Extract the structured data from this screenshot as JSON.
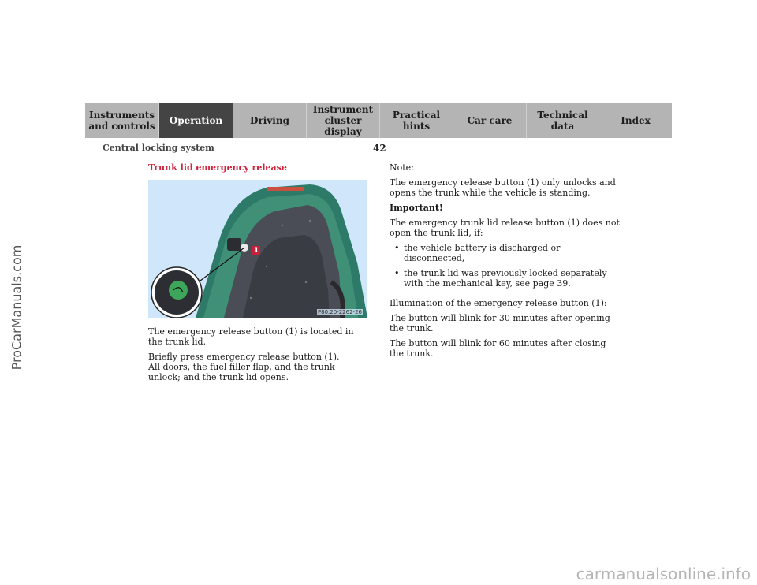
{
  "watermark_side": "ProCarManuals.com",
  "watermark_bottom": "carmanualsonline.info",
  "nav": {
    "tabs": [
      {
        "label": "Instruments\nand controls",
        "active": false
      },
      {
        "label": "Operation",
        "active": true
      },
      {
        "label": "Driving",
        "active": false
      },
      {
        "label": "Instrument\ncluster display",
        "active": false
      },
      {
        "label": "Practical hints",
        "active": false
      },
      {
        "label": "Car care",
        "active": false
      },
      {
        "label": "Technical\ndata",
        "active": false
      },
      {
        "label": "Index",
        "active": false
      }
    ]
  },
  "header": {
    "section": "Central locking system",
    "page_number": "42"
  },
  "content": {
    "title": "Trunk lid emergency release",
    "figure": {
      "code": "P80.20-2262-26",
      "callout": "1"
    },
    "left_paragraphs": [
      "The emergency release button (1) is located in the trunk lid.",
      "Briefly press emergency release button (1).",
      "All doors, the fuel filler flap, and the trunk unlock; and the trunk lid opens."
    ],
    "note_label": "Note:",
    "note_text": "The emergency release button (1) only unlocks and opens the trunk while the vehicle is standing.",
    "important_label": "Important!",
    "important_text": "The emergency trunk lid release button (1) does not open the trunk lid, if:",
    "bullets": [
      "the vehicle battery is discharged or disconnected,",
      "the trunk lid was previously locked separately with the mechanical key, see page 39."
    ],
    "illumination_heading": "Illumination of the emergency release button (1):",
    "illumination_lines": [
      "The button will blink for 30 minutes after opening the trunk.",
      "The button will blink for 60 minutes after closing the trunk."
    ]
  }
}
